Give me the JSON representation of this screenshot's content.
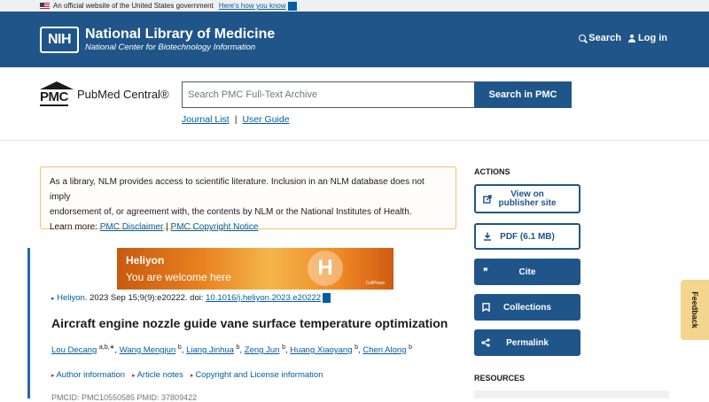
{
  "gov_banner": {
    "text": "An official website of the United States government",
    "link": "Here's how you know"
  },
  "header": {
    "logo": "NIH",
    "title": "National Library of Medicine",
    "subtitle": "National Center for Biotechnology Information",
    "search_label": "Search",
    "login_label": "Log in"
  },
  "pmc": {
    "mark": "PMC",
    "name": "PubMed Central®",
    "search_placeholder": "Search PMC Full-Text Archive",
    "search_button": "Search in PMC",
    "links": [
      "Journal List",
      "User Guide"
    ]
  },
  "notice": {
    "line1": "As a library, NLM provides access to scientific literature. Inclusion in an NLM database does not imply",
    "line2": "endorsement of, or agreement with, the contents by NLM or the National Institutes of Health.",
    "learn_more": "Learn more:",
    "disclaimer_link": "PMC Disclaimer",
    "sep": "|",
    "copyright_link": "PMC Copyright Notice"
  },
  "banner": {
    "journal": "Heliyon",
    "tagline": "You are welcome here",
    "emblem": "H",
    "publisher": "CellPress"
  },
  "article": {
    "journal": "Heliyon",
    "citation_rest": ". 2023 Sep 15;9(9):e20222. doi: ",
    "doi": "10.1016/j.heliyon.2023.e20222",
    "title": "Aircraft engine nozzle guide vane surface temperature optimization",
    "authors": [
      {
        "name": "Lou Decang",
        "sup": "a,b,∗"
      },
      {
        "name": "Wang Mengjun",
        "sup": "b"
      },
      {
        "name": "Liang Jinhua",
        "sup": "b"
      },
      {
        "name": "Zeng Jun",
        "sup": "b"
      },
      {
        "name": "Huang Xiaoyang",
        "sup": "b"
      },
      {
        "name": "Chen Along",
        "sup": "b"
      }
    ],
    "meta_links": [
      "Author information",
      "Article notes",
      "Copyright and License information"
    ],
    "pmcid_line": "PMCID: PMC10550585  PMID: 37809422"
  },
  "sidebar": {
    "actions_title": "ACTIONS",
    "view_publisher_1": "View on",
    "view_publisher_2": "publisher site",
    "pdf": "PDF (6.1 MB)",
    "cite": "Cite",
    "collections": "Collections",
    "permalink": "Permalink",
    "resources_title": "RESOURCES"
  },
  "feedback": "Feedback",
  "colors": {
    "brand_blue": "#20558a",
    "link_blue": "#005ea2",
    "notice_border": "#f4c06b",
    "feedback_bg": "#f4d58d"
  }
}
